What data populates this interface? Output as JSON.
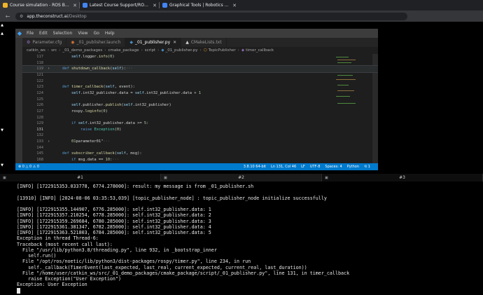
{
  "browser": {
    "tabs": [
      {
        "title": "Course simulation - ROS Basics",
        "active": true,
        "favicon_color": "#f0b429"
      },
      {
        "title": "Latest Course Support/ROS Ba...",
        "active": false,
        "favicon_color": "#4285f4"
      },
      {
        "title": "Graphical Tools | Robotics & R...",
        "active": false,
        "favicon_color": "#4285f4"
      }
    ],
    "url_host": "app.theconstruct.ai",
    "url_path": "/Desktop"
  },
  "editor": {
    "menu": [
      "File",
      "Edit",
      "Selection",
      "View",
      "Go",
      "Help"
    ],
    "tabs": [
      {
        "label": "Parameter.cfg",
        "icon": "gear-icon",
        "active": false
      },
      {
        "label": "_01_publisher.launch",
        "icon": "rss-icon",
        "active": false
      },
      {
        "label": "_01_publisher.py",
        "icon": "python-icon",
        "active": true
      },
      {
        "label": "CMakeLists.txt",
        "icon": "cmake-icon",
        "active": false
      }
    ],
    "breadcrumb": [
      "catkin_ws",
      "src",
      "_01_demo_packages",
      "cmake_package",
      "script",
      "_01_publisher.py",
      "TopicPublisher",
      "timer_callback"
    ],
    "lines": [
      {
        "n": "117",
        "html": "        self.logger.info(f\"{self.nodeName} initialize successfully\\n\")"
      },
      {
        "n": "118",
        "html": ""
      },
      {
        "n": "119",
        "html": "    def shutdown_callback(self):···",
        "fold": "›",
        "hl": true
      },
      {
        "n": "121",
        "html": ""
      },
      {
        "n": "122",
        "html": ""
      },
      {
        "n": "123",
        "html": "    def timer_callback(self, event):"
      },
      {
        "n": "124",
        "html": "        self.int32_publisher.data = self.int32_publisher.data + 1"
      },
      {
        "n": "125",
        "html": ""
      },
      {
        "n": "126",
        "html": "        self.publisher.publish(self.int32_publisher)"
      },
      {
        "n": "127",
        "html": "        rospy.loginfo(f\"self.int32_publisher.data: {self.int32_publisher.data}\")"
      },
      {
        "n": "128",
        "html": ""
      },
      {
        "n": "129",
        "html": "        if self.int32_publisher.data >= 5:"
      },
      {
        "n": "131",
        "html": "            raise Exception(\"User Exception\")",
        "cur": true
      },
      {
        "n": "132",
        "html": ""
      },
      {
        "n": "133",
        "html": "        \"\"\" # parameter01 = \"parameter01\"···",
        "fold": "›"
      },
      {
        "n": "144",
        "html": ""
      },
      {
        "n": "145",
        "html": "    def subscriber_callback(self, msg):"
      },
      {
        "n": "168",
        "html": "        if msg.data == 10:···"
      }
    ],
    "status_left": [
      "⊗ 0 △ 0 ⚠ 0"
    ],
    "status_right": [
      "3.8.10 64-bit",
      "Ln 131, Col 46",
      "LF",
      "UTF-8",
      "Spaces: 4",
      "Python",
      "⟲ 1"
    ]
  },
  "terminal": {
    "tabs": [
      "#1",
      "#2",
      "#3"
    ],
    "active_tab": 1,
    "lines": [
      "[INFO] [1722915353.033778, 6774.278000]: result: my message is from _01_publisher.sh",
      "",
      "[13910] [INFO] [2024-08-06 03:35:53,039] [topic_publisher_node] : topic_publisher_node initialize successfully",
      "",
      "[INFO] [1722915355.144907, 6776.285000]: self.int32_publisher.data: 1",
      "[INFO] [1722915357.210254, 6778.285000]: self.int32_publisher.data: 2",
      "[INFO] [1722915359.269684, 6780.285000]: self.int32_publisher.data: 3",
      "[INFO] [1722915361.381347, 6782.285000]: self.int32_publisher.data: 4",
      "[INFO] [1722915363.521803, 6784.285000]: self.int32_publisher.data: 5",
      "Exception in thread Thread-6:",
      "Traceback (most recent call last):",
      "  File \"/usr/lib/python3.8/threading.py\", line 932, in _bootstrap_inner",
      "    self.run()",
      "  File \"/opt/ros/noetic/lib/python3/dist-packages/rospy/timer.py\", line 234, in run",
      "    self._callback(TimerEvent(last_expected, last_real, current_expected, current_real, last_duration))",
      "  File \"/home/user/catkin_ws/src/_01_demo_packages/cmake_package/script/_01_publisher.py\", line 131, in timer_callback",
      "    raise Exception(\"User Exception\")",
      "Exception: User Exception"
    ]
  }
}
